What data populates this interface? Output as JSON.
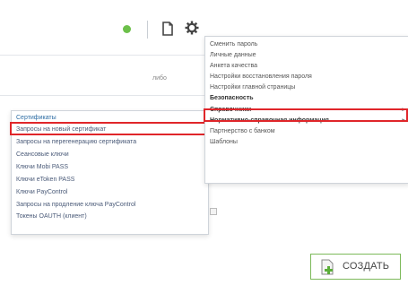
{
  "header": {
    "status_color": "#6cc04a",
    "doc_icon": "document-icon",
    "gear_icon": "gear-icon"
  },
  "background": {
    "column_label": "либо"
  },
  "settings_menu": {
    "items": [
      {
        "label": "Сменить пароль",
        "bold": false
      },
      {
        "label": "Личные данные",
        "bold": false
      },
      {
        "label": "Анкета качества",
        "bold": false
      },
      {
        "label": "Настройки восстановления пароля",
        "bold": false
      },
      {
        "label": "Настройки главной страницы",
        "bold": false
      },
      {
        "label": "Безопасность",
        "bold": true,
        "highlighted": true
      },
      {
        "label": "Справочники",
        "bold": true,
        "submenu": true
      },
      {
        "label": "Нормативно-справочная информация",
        "bold": true,
        "submenu": true
      },
      {
        "label": "Партнерство с банком",
        "bold": false
      },
      {
        "label": "Шаблоны",
        "bold": false
      }
    ]
  },
  "security_menu": {
    "items": [
      {
        "label": "Сертификаты"
      },
      {
        "label": "Запросы на новый сертификат",
        "highlighted": true
      },
      {
        "label": "Запросы на перегенерацию сертификата"
      },
      {
        "label": "Сеансовые ключи"
      },
      {
        "label": "Ключи Mobi PASS"
      },
      {
        "label": "Ключи eToken PASS"
      },
      {
        "label": "Ключи PayControl"
      },
      {
        "label": "Запросы на продление ключа PayControl"
      },
      {
        "label": "Токены OAUTH (клиент)"
      }
    ]
  },
  "create_button": {
    "label": "СОЗДАТЬ",
    "accent": "#5cae3a"
  },
  "accent_highlight": "#e0262a"
}
